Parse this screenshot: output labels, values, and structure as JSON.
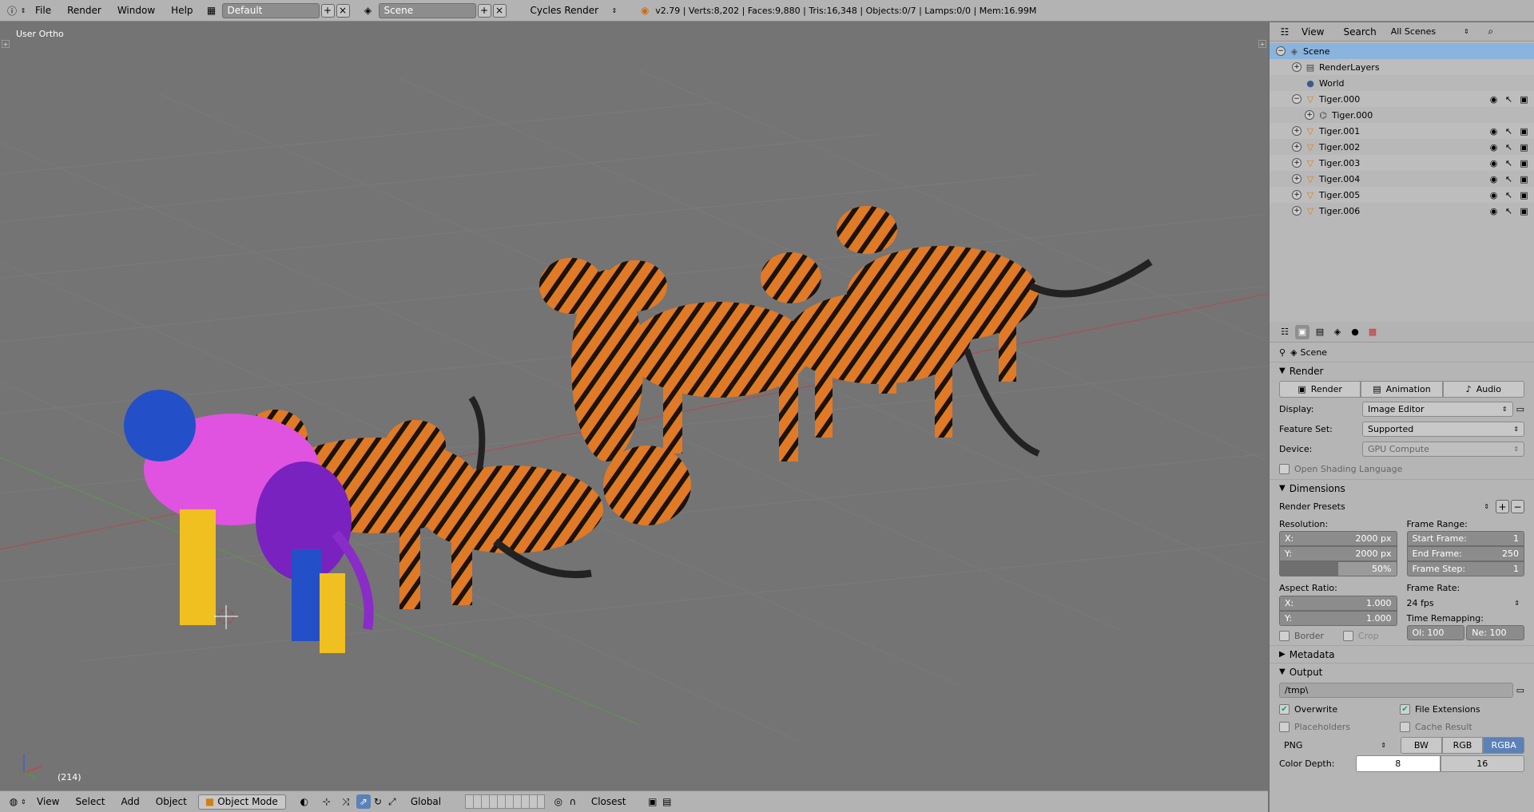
{
  "topbar": {
    "menus": [
      "File",
      "Render",
      "Window",
      "Help"
    ],
    "layout": "Default",
    "scene": "Scene",
    "engine": "Cycles Render",
    "stats": "v2.79 | Verts:8,202 | Faces:9,880 | Tris:16,348 | Objects:0/7 | Lamps:0/0 | Mem:16.99M"
  },
  "viewport": {
    "view_label": "User Ortho",
    "frame": "(214)"
  },
  "bottombar": {
    "menus": [
      "View",
      "Select",
      "Add",
      "Object"
    ],
    "mode": "Object Mode",
    "orientation": "Global",
    "snap": "Closest"
  },
  "outliner": {
    "menus": [
      "View",
      "Search"
    ],
    "filter": "All Scenes",
    "items": [
      {
        "label": "Scene",
        "icon": "scene-icon"
      },
      {
        "label": "RenderLayers",
        "icon": "renderlayers-icon"
      },
      {
        "label": "World",
        "icon": "world-icon"
      },
      {
        "label": "Tiger.000",
        "icon": "object-icon"
      },
      {
        "label": "Tiger.000",
        "icon": "mesh-icon"
      },
      {
        "label": "Tiger.001",
        "icon": "object-icon"
      },
      {
        "label": "Tiger.002",
        "icon": "object-icon"
      },
      {
        "label": "Tiger.003",
        "icon": "object-icon"
      },
      {
        "label": "Tiger.004",
        "icon": "object-icon"
      },
      {
        "label": "Tiger.005",
        "icon": "object-icon"
      },
      {
        "label": "Tiger.006",
        "icon": "object-icon"
      }
    ]
  },
  "properties": {
    "context": "Scene",
    "render_panel": "Render",
    "render_buttons": [
      "Render",
      "Animation",
      "Audio"
    ],
    "display_label": "Display:",
    "display_value": "Image Editor",
    "featureset_label": "Feature Set:",
    "featureset_value": "Supported",
    "device_label": "Device:",
    "device_value": "GPU Compute",
    "osl_label": "Open Shading Language",
    "dimensions_panel": "Dimensions",
    "render_presets": "Render Presets",
    "resolution_label": "Resolution:",
    "res_x_label": "X:",
    "res_x": "2000 px",
    "res_y_label": "Y:",
    "res_y": "2000 px",
    "res_pct": "50%",
    "frame_range_label": "Frame Range:",
    "start_label": "Start Frame:",
    "start": "1",
    "end_label": "End Frame:",
    "end": "250",
    "step_label": "Frame Step:",
    "step": "1",
    "aspect_label": "Aspect Ratio:",
    "asp_x_label": "X:",
    "asp_x": "1.000",
    "asp_y_label": "Y:",
    "asp_y": "1.000",
    "framerate_label": "Frame Rate:",
    "framerate": "24 fps",
    "remap_label": "Time Remapping:",
    "remap_old": "Ol: 100",
    "remap_new": "Ne: 100",
    "border_label": "Border",
    "crop_label": "Crop",
    "metadata_panel": "Metadata",
    "output_panel": "Output",
    "output_path": "/tmp\\",
    "overwrite_label": "Overwrite",
    "file_ext_label": "File Extensions",
    "placeholders_label": "Placeholders",
    "cache_label": "Cache Result",
    "format": "PNG",
    "color_modes": [
      "BW",
      "RGB",
      "RGBA"
    ],
    "color_depth_label": "Color Depth:",
    "color_depths": [
      "8",
      "16"
    ]
  }
}
